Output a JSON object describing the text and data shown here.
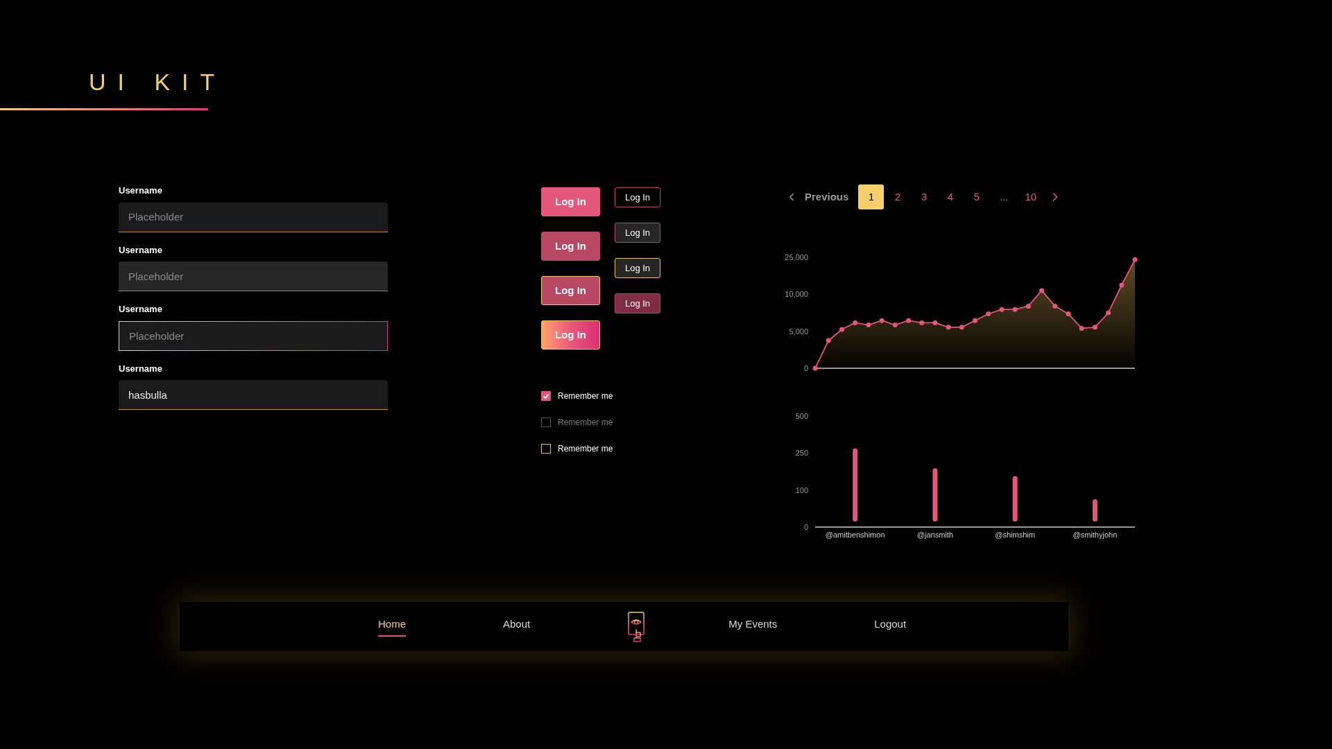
{
  "title": "UI KIT",
  "inputs": [
    {
      "label": "Username",
      "placeholder": "Placeholder",
      "kind": "default"
    },
    {
      "label": "Username",
      "placeholder": "Placeholder",
      "kind": "hover"
    },
    {
      "label": "Username",
      "placeholder": "Placeholder",
      "kind": "focus"
    },
    {
      "label": "Username",
      "value": "hasbulla",
      "kind": "default"
    }
  ],
  "buttons_large": [
    {
      "label": "Log In",
      "kind": "primary"
    },
    {
      "label": "Log In",
      "kind": "pressed"
    },
    {
      "label": "Log In",
      "kind": "focus"
    },
    {
      "label": "Log In",
      "kind": "gradient"
    }
  ],
  "buttons_small": [
    {
      "label": "Log In",
      "kind": "outline"
    },
    {
      "label": "Log In",
      "kind": "dark"
    },
    {
      "label": "Log In",
      "kind": "dark-focus"
    },
    {
      "label": "Log In",
      "kind": "muted"
    }
  ],
  "checkboxes": [
    {
      "label": "Remember me",
      "checked": true,
      "disabled": false
    },
    {
      "label": "Remember me",
      "checked": false,
      "disabled": true
    },
    {
      "label": "Remember me",
      "checked": false,
      "disabled": false
    }
  ],
  "pagination": {
    "previous": "Previous",
    "pages": [
      {
        "label": "1",
        "selected": true,
        "kind": "page"
      },
      {
        "label": "2",
        "selected": false,
        "kind": "page"
      },
      {
        "label": "3",
        "selected": false,
        "kind": "page"
      },
      {
        "label": "4",
        "selected": false,
        "kind": "page"
      },
      {
        "label": "5",
        "selected": false,
        "kind": "page"
      },
      {
        "label": "...",
        "kind": "ellipsis"
      },
      {
        "label": "10",
        "selected": false,
        "kind": "page"
      }
    ]
  },
  "line_chart": {
    "y_labels": [
      "25,000",
      "10,000",
      "5,000",
      "0"
    ]
  },
  "bar_chart": {
    "y_labels": [
      "500",
      "250",
      "100",
      "0"
    ],
    "x_labels": [
      "@amitbenshimon",
      "@jansmith",
      "@shimshim",
      "@smithyjohn"
    ]
  },
  "nav": [
    {
      "kind": "link",
      "label": "Home",
      "selected": true
    },
    {
      "kind": "link",
      "label": "About",
      "selected": false
    },
    {
      "kind": "logo"
    },
    {
      "kind": "link",
      "label": "My Events",
      "selected": false
    },
    {
      "kind": "link",
      "label": "Logout",
      "selected": false
    }
  ]
}
